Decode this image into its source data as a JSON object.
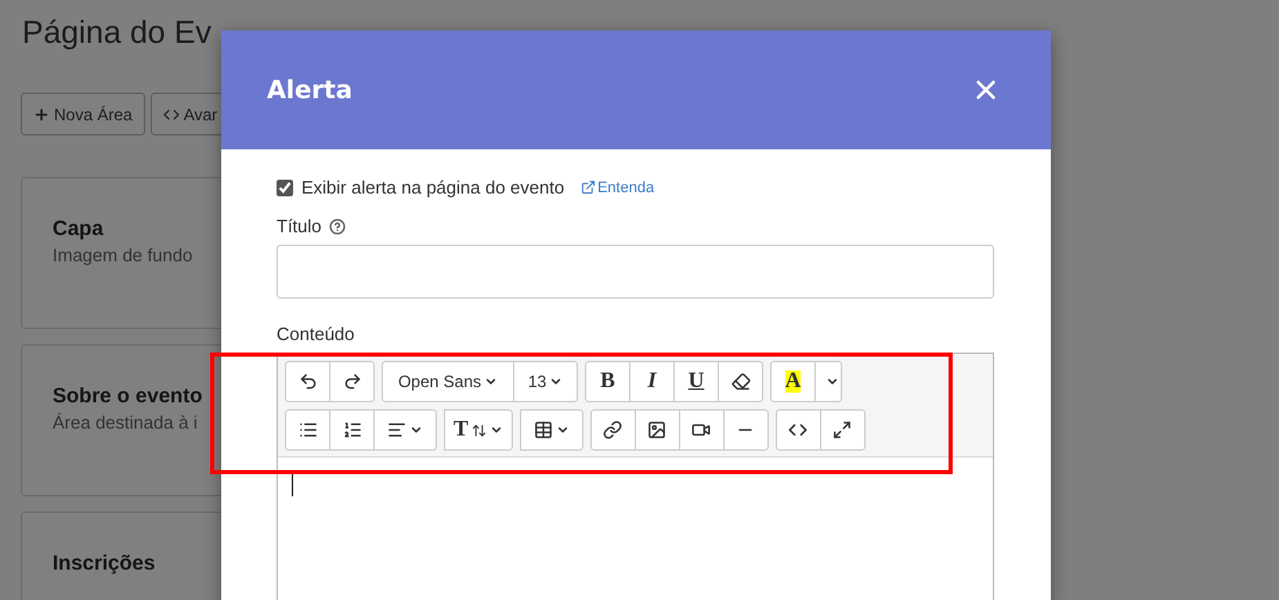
{
  "page": {
    "title": "Página do Ev",
    "buttons": [
      {
        "kind": "add",
        "label": "Nova Área"
      },
      {
        "kind": "code",
        "label": "Avar"
      }
    ],
    "cards": [
      {
        "title": "Capa",
        "description": "Imagem de fundo"
      },
      {
        "title": "Sobre o evento",
        "description": "Área destinada à i"
      },
      {
        "title": "Inscrições"
      }
    ]
  },
  "modal": {
    "title": "Alerta",
    "show_alert": {
      "label": "Exibir alerta na página do evento",
      "checked": true,
      "link": "Entenda"
    },
    "title_field": {
      "label": "Título"
    },
    "content_label": "Conteúdo",
    "toolbar": [
      [
        [
          {
            "kind": "undo"
          },
          {
            "kind": "redo"
          }
        ],
        [
          {
            "kind": "font",
            "label": "Open Sans",
            "dropdown": true
          },
          {
            "kind": "text",
            "label": "13",
            "dropdown": true
          }
        ],
        [
          {
            "kind": "bold",
            "label": "B"
          },
          {
            "kind": "italic",
            "label": "I"
          },
          {
            "kind": "underline",
            "label": "U"
          },
          {
            "kind": "eraser"
          }
        ],
        [
          {
            "kind": "highlight",
            "label": "A"
          },
          {
            "kind": "caret"
          }
        ]
      ],
      [
        [
          {
            "kind": "ul"
          },
          {
            "kind": "ol"
          },
          {
            "kind": "align",
            "dropdown": true
          }
        ],
        [
          {
            "kind": "textsize",
            "label": "T",
            "dropdown": true
          }
        ],
        [
          {
            "kind": "table",
            "dropdown": true
          }
        ],
        [
          {
            "kind": "link"
          },
          {
            "kind": "image"
          },
          {
            "kind": "video"
          },
          {
            "kind": "hr"
          }
        ],
        [
          {
            "kind": "code"
          },
          {
            "kind": "fullscreen"
          }
        ]
      ]
    ],
    "highlighted": true
  }
}
